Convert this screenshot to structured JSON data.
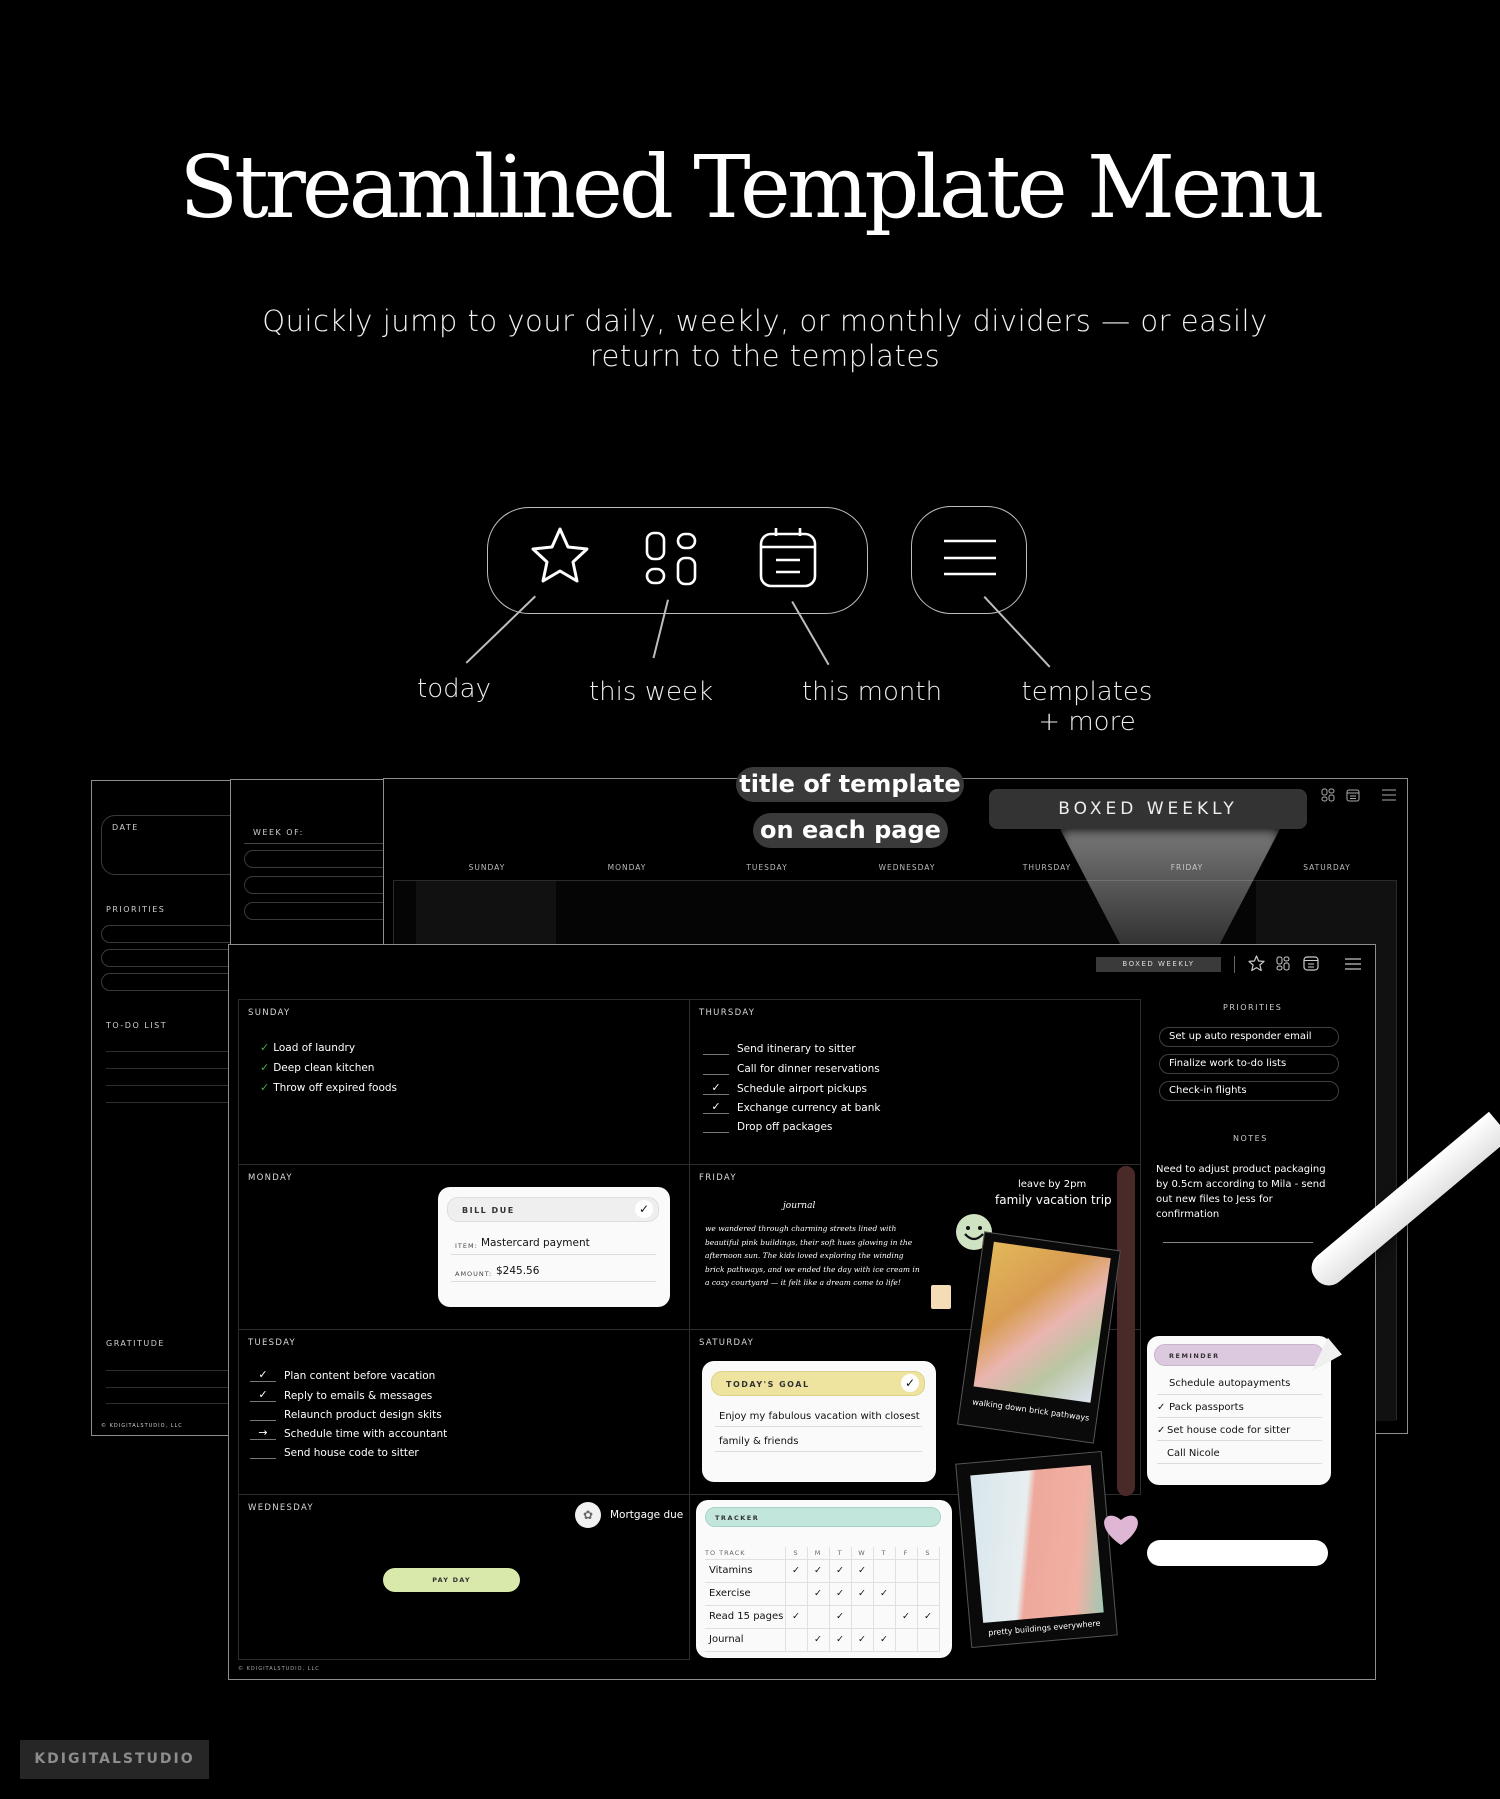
{
  "header": {
    "title": "Streamlined Template Menu",
    "subtitle": "Quickly jump to your daily, weekly, or monthly dividers — or easily return to the templates"
  },
  "menu_diagram": {
    "buttons": [
      {
        "icon": "star-icon",
        "label": "today"
      },
      {
        "icon": "grid-icon",
        "label": "this week"
      },
      {
        "icon": "calendar-icon",
        "label": "this month"
      },
      {
        "icon": "hamburger-menu-icon",
        "label": "templates\n+ more"
      }
    ]
  },
  "callout": {
    "line1": "title of template",
    "line2": "on each page"
  },
  "back_pages": {
    "daily": {
      "date_label": "DATE",
      "priorities_label": "PRIORITIES",
      "todo_label": "TO-DO LIST",
      "gratitude_label": "GRATITUDE",
      "copyright": "© KDIGITALSTUDIO, LLC"
    },
    "weekly_list": {
      "week_of_label": "WEEK OF:"
    },
    "boxed_weekly": {
      "title": "BOXED WEEKLY",
      "weekdays": [
        "SUNDAY",
        "MONDAY",
        "TUESDAY",
        "WEDNESDAY",
        "THURSDAY",
        "FRIDAY",
        "SATURDAY"
      ]
    }
  },
  "front_page": {
    "title_badge": "BOXED WEEKLY",
    "copyright": "© KDIGITALSTUDIO, LLC",
    "days": {
      "sunday": {
        "name": "SUNDAY",
        "todos": [
          {
            "text": "Load of laundry",
            "status": "done"
          },
          {
            "text": "Deep clean kitchen",
            "status": "done"
          },
          {
            "text": "Throw off expired foods",
            "status": "done"
          }
        ]
      },
      "monday": {
        "name": "MONDAY",
        "bill_card": {
          "header": "BILL DUE",
          "item_label": "ITEM:",
          "item_value": "Mastercard payment",
          "amount_label": "AMOUNT:",
          "amount_value": "$245.56"
        }
      },
      "tuesday": {
        "name": "TUESDAY",
        "todos": [
          {
            "text": "Plan content before vacation",
            "mark": "✓"
          },
          {
            "text": "Reply to emails & messages",
            "mark": "✓"
          },
          {
            "text": "Relaunch product design skits",
            "mark": ""
          },
          {
            "text": "Schedule time with accountant",
            "mark": "→"
          },
          {
            "text": "Send house code to sitter",
            "mark": ""
          }
        ]
      },
      "wednesday": {
        "name": "WEDNESDAY",
        "event": "Mortgage due",
        "pay_day": "PAY DAY"
      },
      "thursday": {
        "name": "THURSDAY",
        "todos": [
          {
            "text": "Send itinerary to sitter",
            "mark": ""
          },
          {
            "text": "Call for dinner reservations",
            "mark": ""
          },
          {
            "text": "Schedule airport pickups",
            "mark": "✓"
          },
          {
            "text": "Exchange currency at bank",
            "mark": "✓"
          },
          {
            "text": "Drop off packages",
            "mark": ""
          }
        ]
      },
      "friday": {
        "name": "FRIDAY",
        "journal_title": "journal",
        "journal_text": "we wandered through charming streets lined with beautiful pink buildings, their soft hues glowing in the afternoon sun. The kids loved exploring the winding brick pathways, and we ended the day with ice cream in a cozy courtyard — it felt like a dream come to life!",
        "note_small": "leave by 2pm",
        "note_big": "family vacation trip",
        "photo_caption": "walking down brick pathways"
      },
      "saturday": {
        "name": "SATURDAY",
        "goal_card": {
          "header": "TODAY'S GOAL",
          "line1": "Enjoy my fabulous vacation with closest",
          "line2": "family & friends"
        },
        "tracker": {
          "header": "TRACKER",
          "col_label": "TO TRACK",
          "days": [
            "S",
            "M",
            "T",
            "W",
            "T",
            "F",
            "S"
          ],
          "rows": [
            {
              "name": "Vitamins",
              "checks": [
                true,
                true,
                true,
                true,
                false,
                false,
                false
              ]
            },
            {
              "name": "Exercise",
              "checks": [
                false,
                true,
                true,
                true,
                true,
                false,
                false
              ]
            },
            {
              "name": "Read 15 pages",
              "checks": [
                true,
                false,
                true,
                false,
                false,
                true,
                true
              ]
            },
            {
              "name": "Journal",
              "checks": [
                false,
                true,
                true,
                true,
                true,
                false,
                false
              ]
            }
          ]
        },
        "photo_caption": "pretty buildings everywhere"
      }
    },
    "sidebar": {
      "priorities_label": "PRIORITIES",
      "priorities": [
        "Set up auto responder email",
        "Finalize work to-do lists",
        "Check-in flights"
      ],
      "notes_label": "NOTES",
      "notes_text": "Need to adjust product packaging by 0.5cm according to Mila - send out new files to Jess for confirmation",
      "reminder_card": {
        "header": "REMINDER",
        "items": [
          {
            "text": "Schedule autopayments",
            "done": false
          },
          {
            "text": "Pack passports",
            "done": true
          },
          {
            "text": "Set house code for sitter",
            "done": true
          },
          {
            "text": "Call Nicole",
            "done": false
          }
        ]
      }
    }
  },
  "brand": "KDIGITALSTUDIO",
  "colors": {
    "background": "#000000",
    "goal_yellow": "#efe3a0",
    "tracker_mint": "#c3e6dc",
    "reminder_lilac": "#ddc9df",
    "payday_green": "#d9e9ab",
    "tab_maroon": "#4a2a29",
    "sticker_green": "#cfe3c2",
    "heart_pink": "#dfb6d3"
  }
}
